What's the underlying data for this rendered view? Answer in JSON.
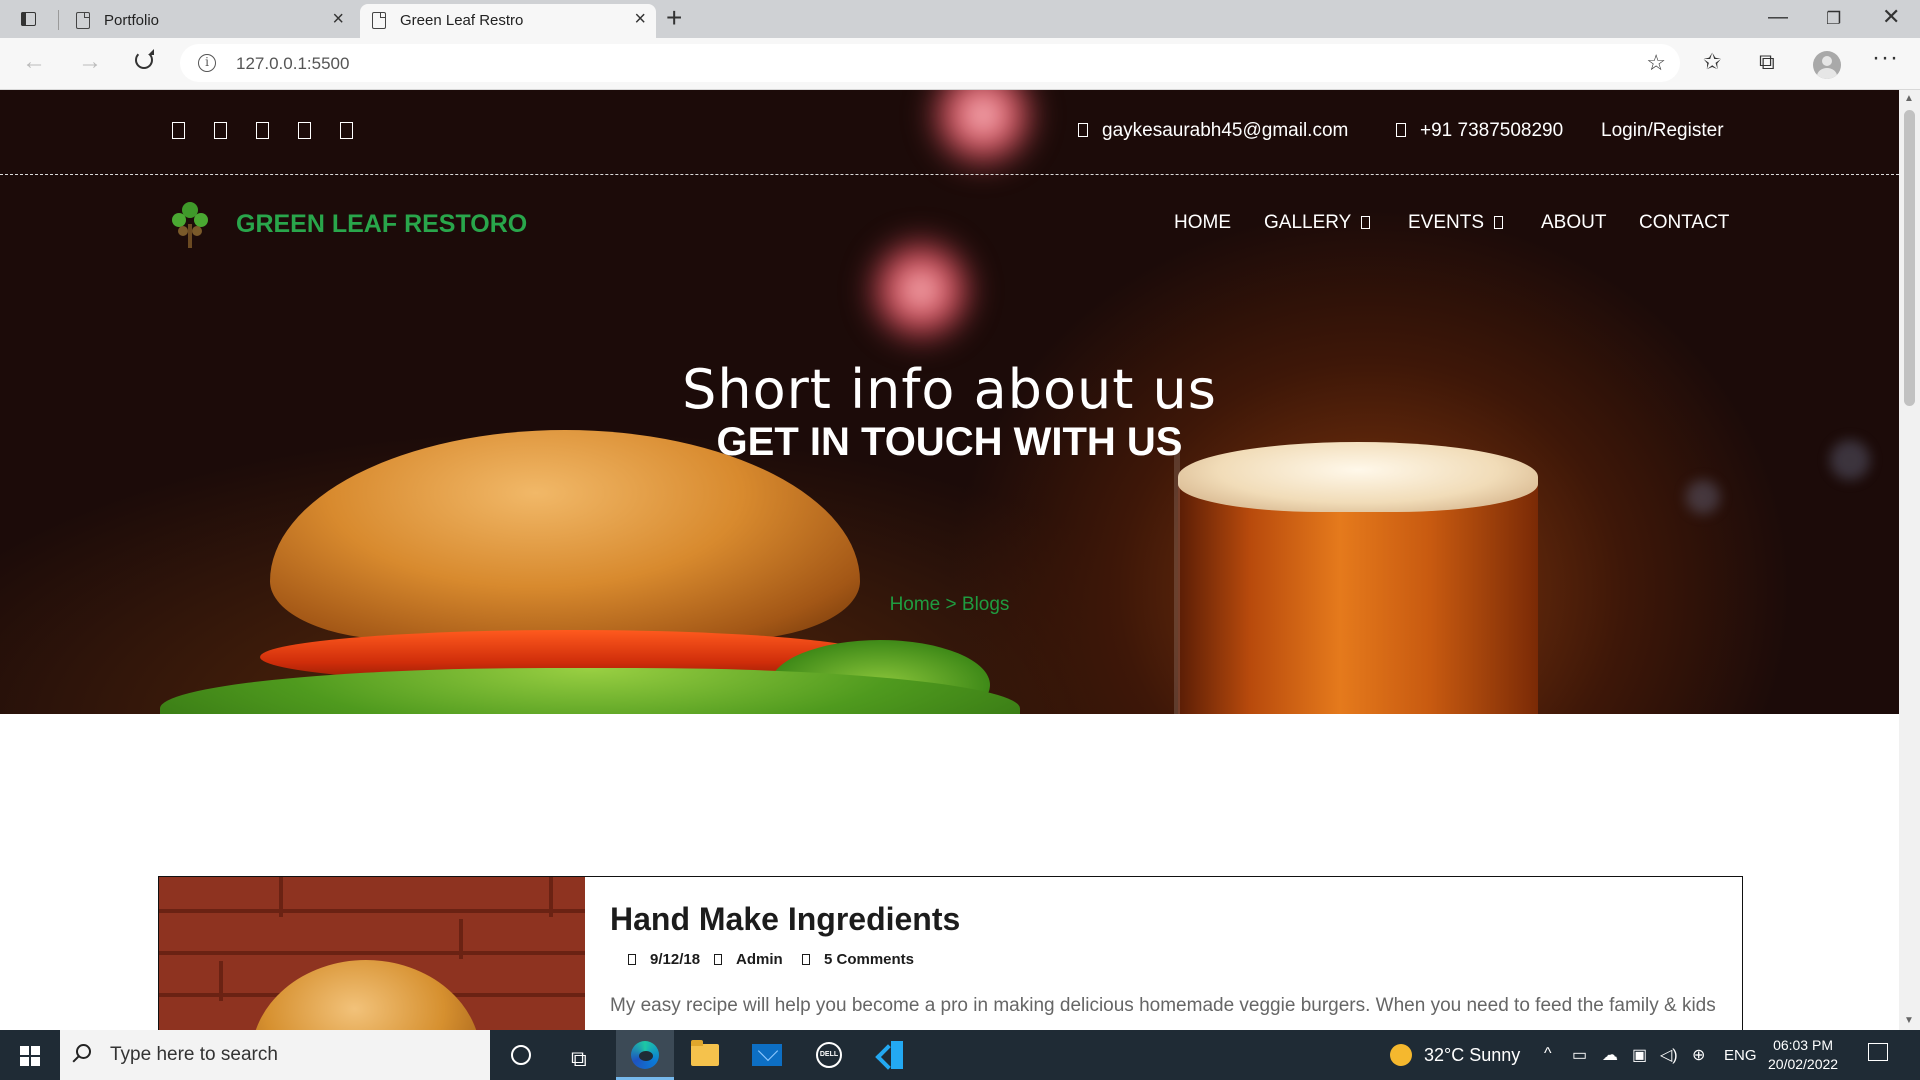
{
  "browser": {
    "tabs": [
      {
        "title": "Portfolio"
      },
      {
        "title": "Green Leaf Restro"
      }
    ],
    "url": "127.0.0.1:5500"
  },
  "site": {
    "topbar": {
      "social_icons": [
        "facebook-icon",
        "twitter-icon",
        "linkedin-icon",
        "instagram-icon",
        "pinterest-icon"
      ],
      "email": "gaykesaurabh45@gmail.com",
      "phone": "+91 7387508290",
      "login": "Login/Register"
    },
    "brand": "GREEN LEAF RESTORO",
    "nav": [
      {
        "label": "HOME"
      },
      {
        "label": "GALLERY"
      },
      {
        "label": "EVENTS"
      },
      {
        "label": "ABOUT"
      },
      {
        "label": "CONTACT"
      }
    ],
    "hero": {
      "title": "Short info about us",
      "subtitle": "GET IN TOUCH WITH US",
      "breadcrumb": "Home > Blogs"
    },
    "post": {
      "title": "Hand Make Ingredients",
      "date": "9/12/18",
      "author": "Admin",
      "comments": "5 Comments",
      "excerpt": "My easy recipe will help you become a pro in making delicious homemade veggie burgers. When you need to feed the family & kids"
    }
  },
  "taskbar": {
    "search_placeholder": "Type here to search",
    "weather": "32°C  Sunny",
    "language": "ENG",
    "time": "06:03 PM",
    "date": "20/02/2022"
  },
  "colors": {
    "brand_green": "#29a64b",
    "breadcrumb_green": "#1f9c40",
    "hero_bg": "#1c0b09",
    "taskbar_bg": "#1f2b35"
  }
}
